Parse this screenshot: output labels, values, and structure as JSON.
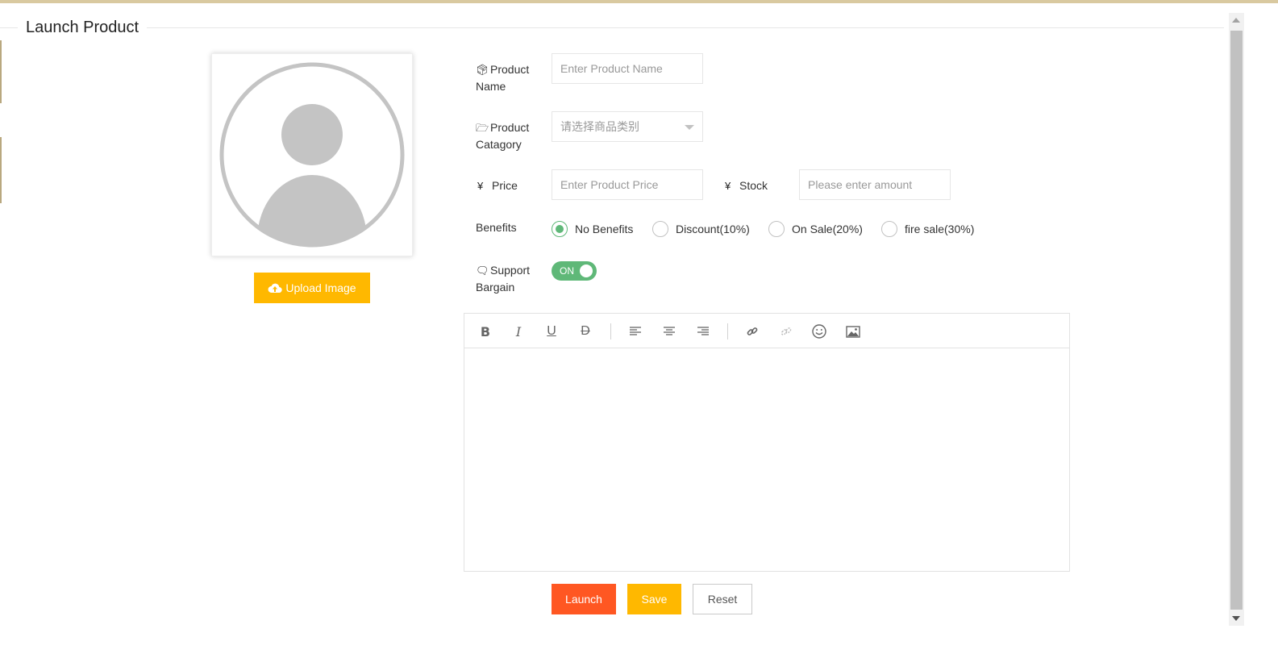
{
  "page": {
    "title": "Launch Product"
  },
  "avatar": {
    "upload_label": "Upload Image"
  },
  "form": {
    "product_name": {
      "label_line1": "Product",
      "label_line2": "Name",
      "placeholder": "Enter Product Name"
    },
    "category": {
      "label_line1": "Product",
      "label_line2": "Catagory",
      "placeholder": "请选择商品类别"
    },
    "price": {
      "label": "Price",
      "currency_icon": "¥",
      "placeholder": "Enter Product Price"
    },
    "stock": {
      "label": "Stock",
      "currency_icon": "¥",
      "placeholder": "Please enter amount"
    },
    "benefits": {
      "label": "Benefits",
      "options": [
        "No Benefits",
        "Discount(10%)",
        "On Sale(20%)",
        "fire sale(30%)"
      ],
      "selected": "No Benefits"
    },
    "bargain": {
      "label_line1": "Support",
      "label_line2": "Bargain",
      "switch_text": "ON"
    }
  },
  "editor": {
    "tools": [
      "bold",
      "italic",
      "underline",
      "strikethrough",
      "align-left",
      "align-center",
      "align-right",
      "link",
      "unlink",
      "emoji",
      "image"
    ]
  },
  "actions": {
    "launch": "Launch",
    "save": "Save",
    "reset": "Reset"
  },
  "colors": {
    "accent_green": "#5fb878",
    "warm_yellow": "#ffb800",
    "danger_orange": "#ff5722"
  }
}
